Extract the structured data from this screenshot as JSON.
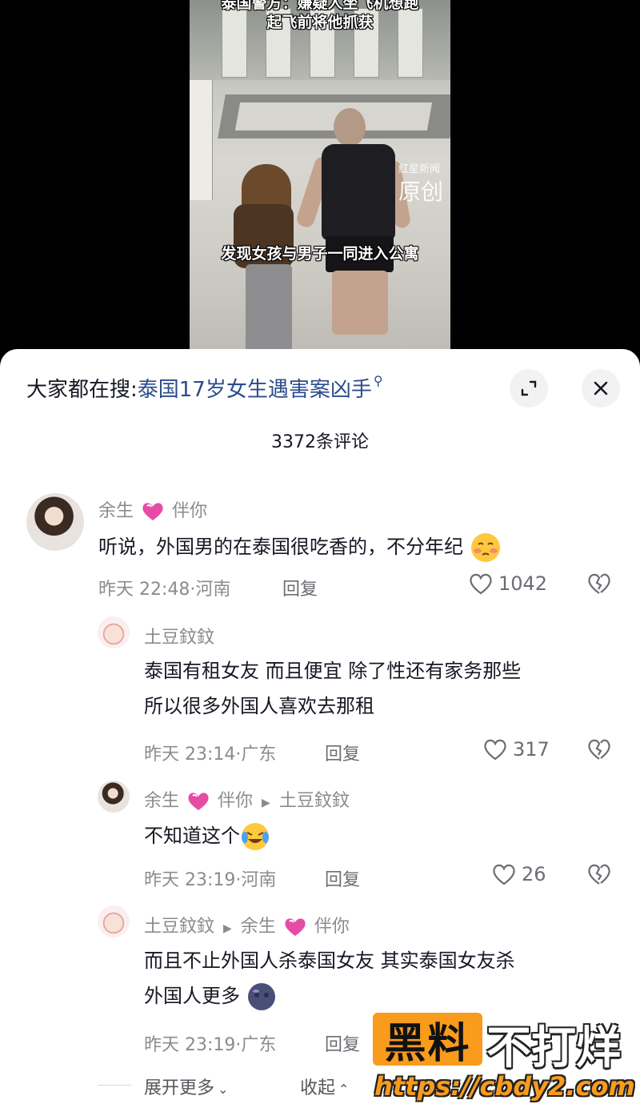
{
  "video": {
    "caption_top_line1": "泰国警方：嫌疑人坐飞机想跑",
    "caption_top_line2": "起飞前将他抓获",
    "caption_mid": "发现女孩与男子一同进入公寓",
    "watermark_source": "红星新闻",
    "watermark_label": "原创"
  },
  "sheet": {
    "search_prefix": "大家都在搜:",
    "search_query": "泰国17岁女生遇害案凶手",
    "comment_count": "3372条评论"
  },
  "comments": [
    {
      "user_a": "余生",
      "user_b": "伴你",
      "text": "听说，外国男的在泰国很吃香的，不分年纪",
      "time": "昨天 22:48·河南",
      "reply": "回复",
      "likes": "1042"
    },
    {
      "user": "土豆鈫鈫",
      "text_line1": "泰国有租女友 而且便宜 除了性还有家务那些",
      "text_line2": "所以很多外国人喜欢去那租",
      "time": "昨天 23:14·广东",
      "reply": "回复",
      "likes": "317"
    },
    {
      "user_a": "余生",
      "user_b": "伴你",
      "reply_to": "土豆鈫鈫",
      "text": "不知道这个",
      "time": "昨天 23:19·河南",
      "reply": "回复",
      "likes": "26"
    },
    {
      "user": "土豆鈫鈫",
      "reply_to_a": "余生",
      "reply_to_b": "伴你",
      "text_line1": "而且不止外国人杀泰国女友 其实泰国女友杀",
      "text_line2": "外国人更多",
      "time": "昨天 23:19·广东",
      "reply": "回复"
    }
  ],
  "footer": {
    "expand_more": "展开更多",
    "collapse": "收起"
  },
  "watermark": {
    "box_text": "黑料",
    "text": "不打烊",
    "url": "https://cbdy2.com"
  },
  "colors": {
    "link_blue": "#2b4c8c",
    "meta_gray": "#8a8b91",
    "brand_orange": "#f99b1c"
  }
}
